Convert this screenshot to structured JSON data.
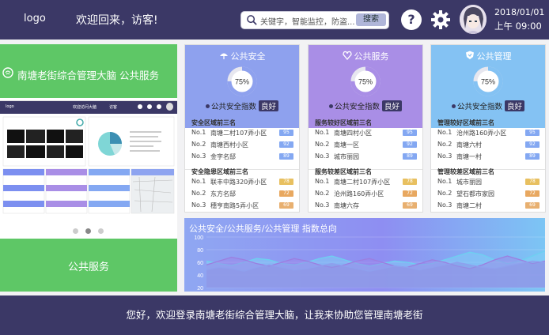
{
  "header": {
    "logo": "logo",
    "welcome": "欢迎回来，访客!",
    "search": {
      "placeholder": "关键字，智能监控，防盗...",
      "button": "搜索"
    },
    "help": "?",
    "date": "2018/01/01",
    "time": "上午 09:00"
  },
  "left": {
    "title": "南塘老街综合管理大脑 公共服务",
    "footer": "公共服务",
    "preview": {
      "bar_logo": "logo",
      "bar_title": "欢迎访问大脑",
      "bar_user": "访客"
    }
  },
  "cards": [
    {
      "title": "公共安全",
      "icon": "umbrella-icon",
      "color": "#8ea1ee",
      "percent": "75%",
      "index_label": "公共安全指数",
      "index_value": "良好",
      "sections": [
        {
          "title": "安全区域前三名",
          "rows": [
            {
              "no": "No.1",
              "name": "南塘二村107弄小区",
              "tag": "95"
            },
            {
              "no": "No.2",
              "name": "南塘西村小区",
              "tag": "92"
            },
            {
              "no": "No.3",
              "name": "金字名邸",
              "tag": "89"
            }
          ]
        },
        {
          "title": "安全隐患区域前三名",
          "rows": [
            {
              "no": "No.1",
              "name": "联丰中路320弄小区",
              "tag": "78"
            },
            {
              "no": "No.2",
              "name": "东方名邸",
              "tag": "72"
            },
            {
              "no": "No.3",
              "name": "穗亨南路5弄小区",
              "tag": "69"
            }
          ]
        }
      ]
    },
    {
      "title": "公共服务",
      "icon": "heart-icon",
      "color": "#a98ee6",
      "percent": "75%",
      "index_label": "公共安全指数",
      "index_value": "良好",
      "sections": [
        {
          "title": "服务较好区域前三名",
          "rows": [
            {
              "no": "No.1",
              "name": "南塘四村小区",
              "tag": "95"
            },
            {
              "no": "No.2",
              "name": "南塘一区",
              "tag": "92"
            },
            {
              "no": "No.3",
              "name": "城市丽园",
              "tag": "89"
            }
          ]
        },
        {
          "title": "服务较差区域前三名",
          "rows": [
            {
              "no": "No.1",
              "name": "南塘二村107弄小区",
              "tag": "78"
            },
            {
              "no": "No.2",
              "name": "沧州路160弄小区",
              "tag": "72"
            },
            {
              "no": "No.3",
              "name": "南塘六存",
              "tag": "69"
            }
          ]
        }
      ]
    },
    {
      "title": "公共管理",
      "icon": "shield-icon",
      "color": "#84c2f3",
      "percent": "75%",
      "index_label": "公共安全指数",
      "index_value": "良好",
      "sections": [
        {
          "title": "管理较好区域前三名",
          "rows": [
            {
              "no": "No.1",
              "name": "沧州路160弄小区",
              "tag": "95"
            },
            {
              "no": "No.2",
              "name": "南塘六村",
              "tag": "92"
            },
            {
              "no": "No.3",
              "name": "南塘一村",
              "tag": "89"
            }
          ]
        },
        {
          "title": "管理较差区域前三名",
          "rows": [
            {
              "no": "No.1",
              "name": "城市丽园",
              "tag": "78"
            },
            {
              "no": "No.2",
              "name": "望石都市家园",
              "tag": "72"
            },
            {
              "no": "No.3",
              "name": "南塘二村",
              "tag": "69"
            }
          ]
        }
      ]
    }
  ],
  "chart_data": {
    "type": "area",
    "title": "公共安全/公共服务/公共管理 指数总向",
    "ylim": [
      20,
      100
    ],
    "yticks": [
      "100",
      "80",
      "60",
      "40",
      "20"
    ],
    "series": [
      {
        "values": [
          62,
          58,
          55,
          60,
          66,
          64,
          58,
          56,
          60,
          66,
          70,
          64,
          58,
          54,
          58,
          62,
          60,
          56,
          58,
          64,
          70,
          76,
          72,
          64,
          58,
          62,
          70,
          78
        ]
      },
      {
        "values": [
          56,
          62,
          68,
          64,
          58,
          54,
          60,
          66,
          62,
          56,
          52,
          56,
          62,
          66,
          60,
          54,
          52,
          58,
          64,
          60,
          54,
          50,
          56,
          64,
          70,
          64,
          58,
          62
        ]
      },
      {
        "values": [
          48,
          52,
          50,
          46,
          52,
          56,
          52,
          48,
          50,
          54,
          58,
          54,
          50,
          46,
          50,
          54,
          52,
          48,
          52,
          56,
          60,
          56,
          52,
          50,
          54,
          58,
          62,
          60
        ]
      }
    ]
  },
  "footer": "您好，欢迎登录南塘老街综合管理大脑，让我来协助您管理南塘老街"
}
